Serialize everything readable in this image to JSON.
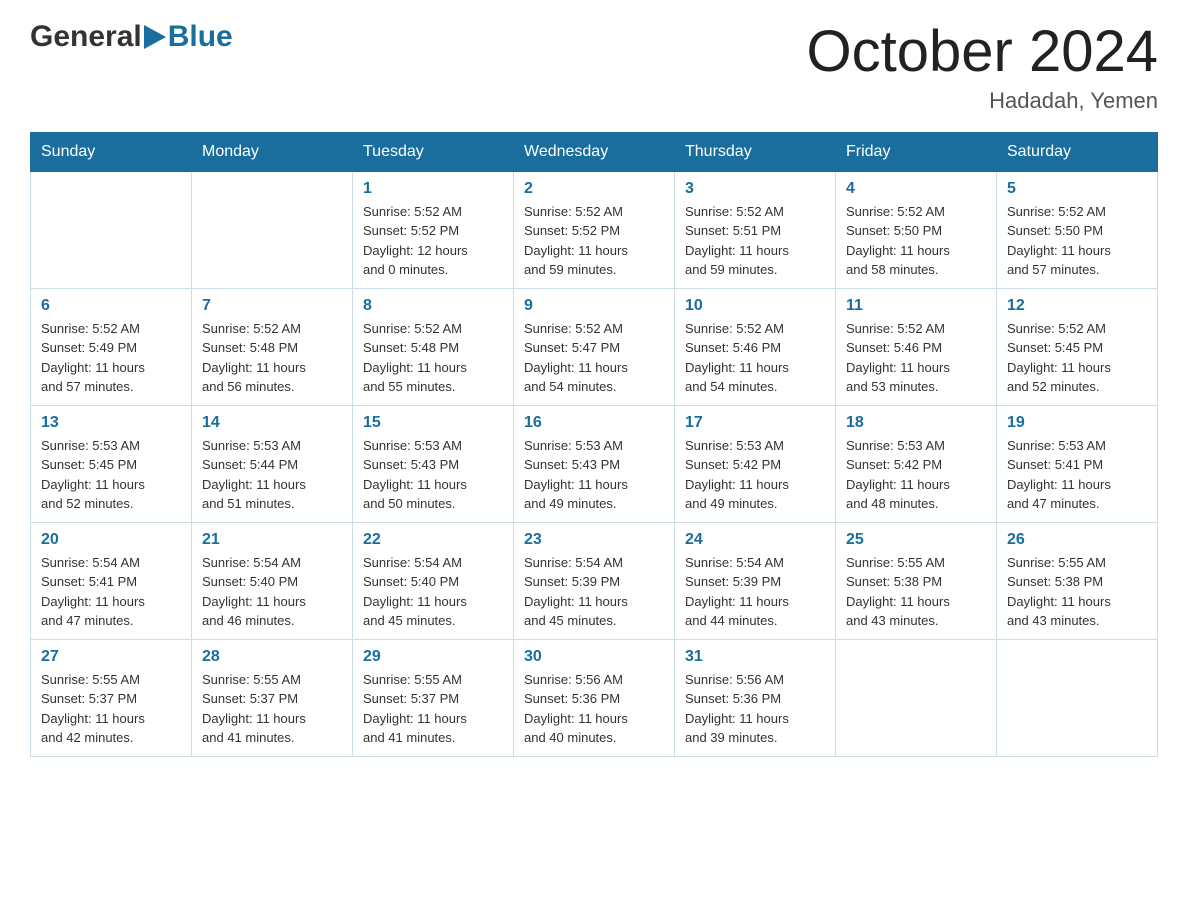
{
  "header": {
    "logo_general": "General",
    "logo_blue": "Blue",
    "month_title": "October 2024",
    "subtitle": "Hadadah, Yemen"
  },
  "calendar": {
    "days_of_week": [
      "Sunday",
      "Monday",
      "Tuesday",
      "Wednesday",
      "Thursday",
      "Friday",
      "Saturday"
    ],
    "weeks": [
      [
        {
          "day": "",
          "info": ""
        },
        {
          "day": "",
          "info": ""
        },
        {
          "day": "1",
          "info": "Sunrise: 5:52 AM\nSunset: 5:52 PM\nDaylight: 12 hours\nand 0 minutes."
        },
        {
          "day": "2",
          "info": "Sunrise: 5:52 AM\nSunset: 5:52 PM\nDaylight: 11 hours\nand 59 minutes."
        },
        {
          "day": "3",
          "info": "Sunrise: 5:52 AM\nSunset: 5:51 PM\nDaylight: 11 hours\nand 59 minutes."
        },
        {
          "day": "4",
          "info": "Sunrise: 5:52 AM\nSunset: 5:50 PM\nDaylight: 11 hours\nand 58 minutes."
        },
        {
          "day": "5",
          "info": "Sunrise: 5:52 AM\nSunset: 5:50 PM\nDaylight: 11 hours\nand 57 minutes."
        }
      ],
      [
        {
          "day": "6",
          "info": "Sunrise: 5:52 AM\nSunset: 5:49 PM\nDaylight: 11 hours\nand 57 minutes."
        },
        {
          "day": "7",
          "info": "Sunrise: 5:52 AM\nSunset: 5:48 PM\nDaylight: 11 hours\nand 56 minutes."
        },
        {
          "day": "8",
          "info": "Sunrise: 5:52 AM\nSunset: 5:48 PM\nDaylight: 11 hours\nand 55 minutes."
        },
        {
          "day": "9",
          "info": "Sunrise: 5:52 AM\nSunset: 5:47 PM\nDaylight: 11 hours\nand 54 minutes."
        },
        {
          "day": "10",
          "info": "Sunrise: 5:52 AM\nSunset: 5:46 PM\nDaylight: 11 hours\nand 54 minutes."
        },
        {
          "day": "11",
          "info": "Sunrise: 5:52 AM\nSunset: 5:46 PM\nDaylight: 11 hours\nand 53 minutes."
        },
        {
          "day": "12",
          "info": "Sunrise: 5:52 AM\nSunset: 5:45 PM\nDaylight: 11 hours\nand 52 minutes."
        }
      ],
      [
        {
          "day": "13",
          "info": "Sunrise: 5:53 AM\nSunset: 5:45 PM\nDaylight: 11 hours\nand 52 minutes."
        },
        {
          "day": "14",
          "info": "Sunrise: 5:53 AM\nSunset: 5:44 PM\nDaylight: 11 hours\nand 51 minutes."
        },
        {
          "day": "15",
          "info": "Sunrise: 5:53 AM\nSunset: 5:43 PM\nDaylight: 11 hours\nand 50 minutes."
        },
        {
          "day": "16",
          "info": "Sunrise: 5:53 AM\nSunset: 5:43 PM\nDaylight: 11 hours\nand 49 minutes."
        },
        {
          "day": "17",
          "info": "Sunrise: 5:53 AM\nSunset: 5:42 PM\nDaylight: 11 hours\nand 49 minutes."
        },
        {
          "day": "18",
          "info": "Sunrise: 5:53 AM\nSunset: 5:42 PM\nDaylight: 11 hours\nand 48 minutes."
        },
        {
          "day": "19",
          "info": "Sunrise: 5:53 AM\nSunset: 5:41 PM\nDaylight: 11 hours\nand 47 minutes."
        }
      ],
      [
        {
          "day": "20",
          "info": "Sunrise: 5:54 AM\nSunset: 5:41 PM\nDaylight: 11 hours\nand 47 minutes."
        },
        {
          "day": "21",
          "info": "Sunrise: 5:54 AM\nSunset: 5:40 PM\nDaylight: 11 hours\nand 46 minutes."
        },
        {
          "day": "22",
          "info": "Sunrise: 5:54 AM\nSunset: 5:40 PM\nDaylight: 11 hours\nand 45 minutes."
        },
        {
          "day": "23",
          "info": "Sunrise: 5:54 AM\nSunset: 5:39 PM\nDaylight: 11 hours\nand 45 minutes."
        },
        {
          "day": "24",
          "info": "Sunrise: 5:54 AM\nSunset: 5:39 PM\nDaylight: 11 hours\nand 44 minutes."
        },
        {
          "day": "25",
          "info": "Sunrise: 5:55 AM\nSunset: 5:38 PM\nDaylight: 11 hours\nand 43 minutes."
        },
        {
          "day": "26",
          "info": "Sunrise: 5:55 AM\nSunset: 5:38 PM\nDaylight: 11 hours\nand 43 minutes."
        }
      ],
      [
        {
          "day": "27",
          "info": "Sunrise: 5:55 AM\nSunset: 5:37 PM\nDaylight: 11 hours\nand 42 minutes."
        },
        {
          "day": "28",
          "info": "Sunrise: 5:55 AM\nSunset: 5:37 PM\nDaylight: 11 hours\nand 41 minutes."
        },
        {
          "day": "29",
          "info": "Sunrise: 5:55 AM\nSunset: 5:37 PM\nDaylight: 11 hours\nand 41 minutes."
        },
        {
          "day": "30",
          "info": "Sunrise: 5:56 AM\nSunset: 5:36 PM\nDaylight: 11 hours\nand 40 minutes."
        },
        {
          "day": "31",
          "info": "Sunrise: 5:56 AM\nSunset: 5:36 PM\nDaylight: 11 hours\nand 39 minutes."
        },
        {
          "day": "",
          "info": ""
        },
        {
          "day": "",
          "info": ""
        }
      ]
    ]
  }
}
